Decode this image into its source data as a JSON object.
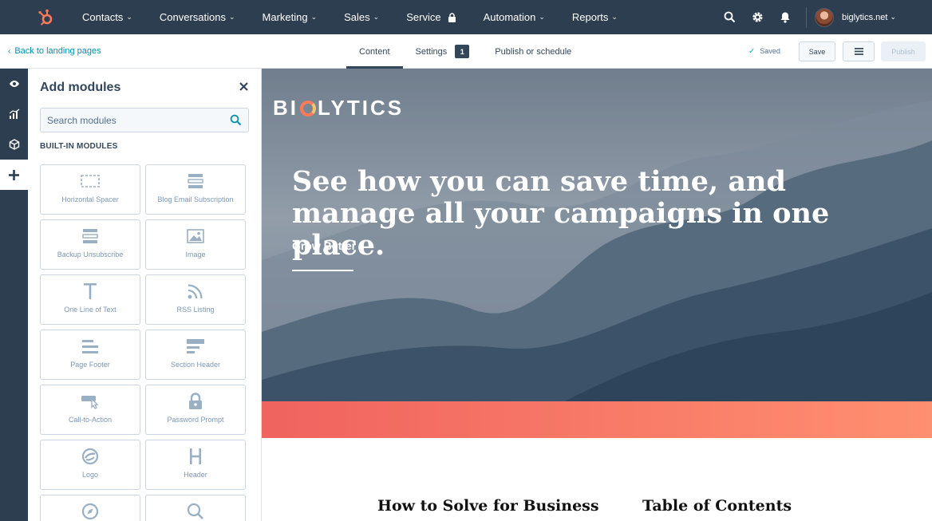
{
  "topnav": {
    "items": [
      {
        "label": "Contacts",
        "chevron": true
      },
      {
        "label": "Conversations",
        "chevron": true
      },
      {
        "label": "Marketing",
        "chevron": true
      },
      {
        "label": "Sales",
        "chevron": true
      },
      {
        "label": "Service",
        "lock": true
      },
      {
        "label": "Automation",
        "chevron": true
      },
      {
        "label": "Reports",
        "chevron": true
      }
    ],
    "account": "biglytics.net",
    "brand_color": "#ff7a59"
  },
  "editor": {
    "back_label": "Back to landing pages",
    "tabs": [
      {
        "label": "Content",
        "active": true
      },
      {
        "label": "Settings",
        "badge": "1"
      },
      {
        "label": "Publish or schedule"
      }
    ],
    "saved_label": "Saved",
    "save_label": "Save",
    "publish_label": "Publish"
  },
  "panel": {
    "title": "Add modules",
    "search_placeholder": "Search modules",
    "section_label": "BUILT-IN MODULES",
    "modules": [
      {
        "label": "Horizontal Spacer",
        "icon": "spacer-icon"
      },
      {
        "label": "Blog Email Subscription",
        "icon": "blog-subscription-icon"
      },
      {
        "label": "Backup Unsubscribe",
        "icon": "unsubscribe-icon"
      },
      {
        "label": "Image",
        "icon": "image-icon"
      },
      {
        "label": "One Line of Text",
        "icon": "text-icon"
      },
      {
        "label": "RSS Listing",
        "icon": "rss-icon"
      },
      {
        "label": "Page Footer",
        "icon": "footer-icon"
      },
      {
        "label": "Section Header",
        "icon": "section-header-icon"
      },
      {
        "label": "Call-to-Action",
        "icon": "cta-icon"
      },
      {
        "label": "Password Prompt",
        "icon": "lock-icon"
      },
      {
        "label": "Logo",
        "icon": "logo-icon"
      },
      {
        "label": "Header",
        "icon": "header-icon"
      },
      {
        "label": "",
        "icon": "compass-icon"
      },
      {
        "label": "",
        "icon": "search-icon"
      }
    ]
  },
  "canvas": {
    "brand": {
      "before": "BI",
      "after": "LYTICS"
    },
    "headline": "See how you can save time, and manage all your campaigns in one place.",
    "subhead": "Grow Better",
    "section_left": "How to Solve for Business",
    "section_right": "Table of Contents",
    "band_colors": [
      "#f0635f",
      "#ff8f70"
    ]
  }
}
